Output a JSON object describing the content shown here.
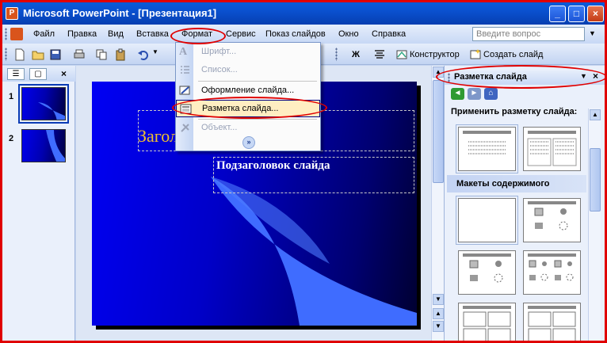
{
  "window": {
    "title": "Microsoft PowerPoint - [Презентация1]",
    "buttons": {
      "minimize": "_",
      "maximize": "□",
      "close": "×"
    }
  },
  "menubar": {
    "items": [
      "Файл",
      "Правка",
      "Вид",
      "Вставка",
      "Формат",
      "Сервис",
      "Показ слайдов",
      "Окно",
      "Справка"
    ],
    "help_placeholder": "Введите вопрос"
  },
  "toolbar": {
    "bold_label": "Ж",
    "designer_label": "Конструктор",
    "new_slide_label": "Создать слайд"
  },
  "format_menu": {
    "items": [
      {
        "label": "Шрифт...",
        "disabled": true,
        "icon": "font-icon"
      },
      {
        "label": "Список...",
        "disabled": true,
        "icon": "list-icon"
      },
      {
        "label": "Оформление слайда...",
        "disabled": false,
        "icon": "slide-design-icon"
      },
      {
        "label": "Разметка слайда...",
        "disabled": false,
        "highlighted": true,
        "icon": "slide-layout-icon"
      },
      {
        "label": "Объект...",
        "disabled": true,
        "icon": "object-icon"
      }
    ],
    "expand_icon": "chevron-double-down-icon"
  },
  "slides_pane": {
    "tabs": [
      "outline-tab",
      "slides-tab"
    ],
    "close": "×",
    "slides": [
      {
        "number": "1",
        "selected": true
      },
      {
        "number": "2",
        "selected": false
      }
    ]
  },
  "slide": {
    "title": "Загол",
    "subtitle": "Подзаголовок слайда"
  },
  "task_pane": {
    "title": "Разметка слайда",
    "close": "×",
    "apply_label": "Применить разметку слайда:",
    "section_content": "Макеты содержимого"
  },
  "colors": {
    "titlebar": "#0a50cf",
    "slide_bg": "#0000c8",
    "title_text": "#f0c030",
    "highlight": "#ffeec2",
    "annotation": "#e00000"
  }
}
